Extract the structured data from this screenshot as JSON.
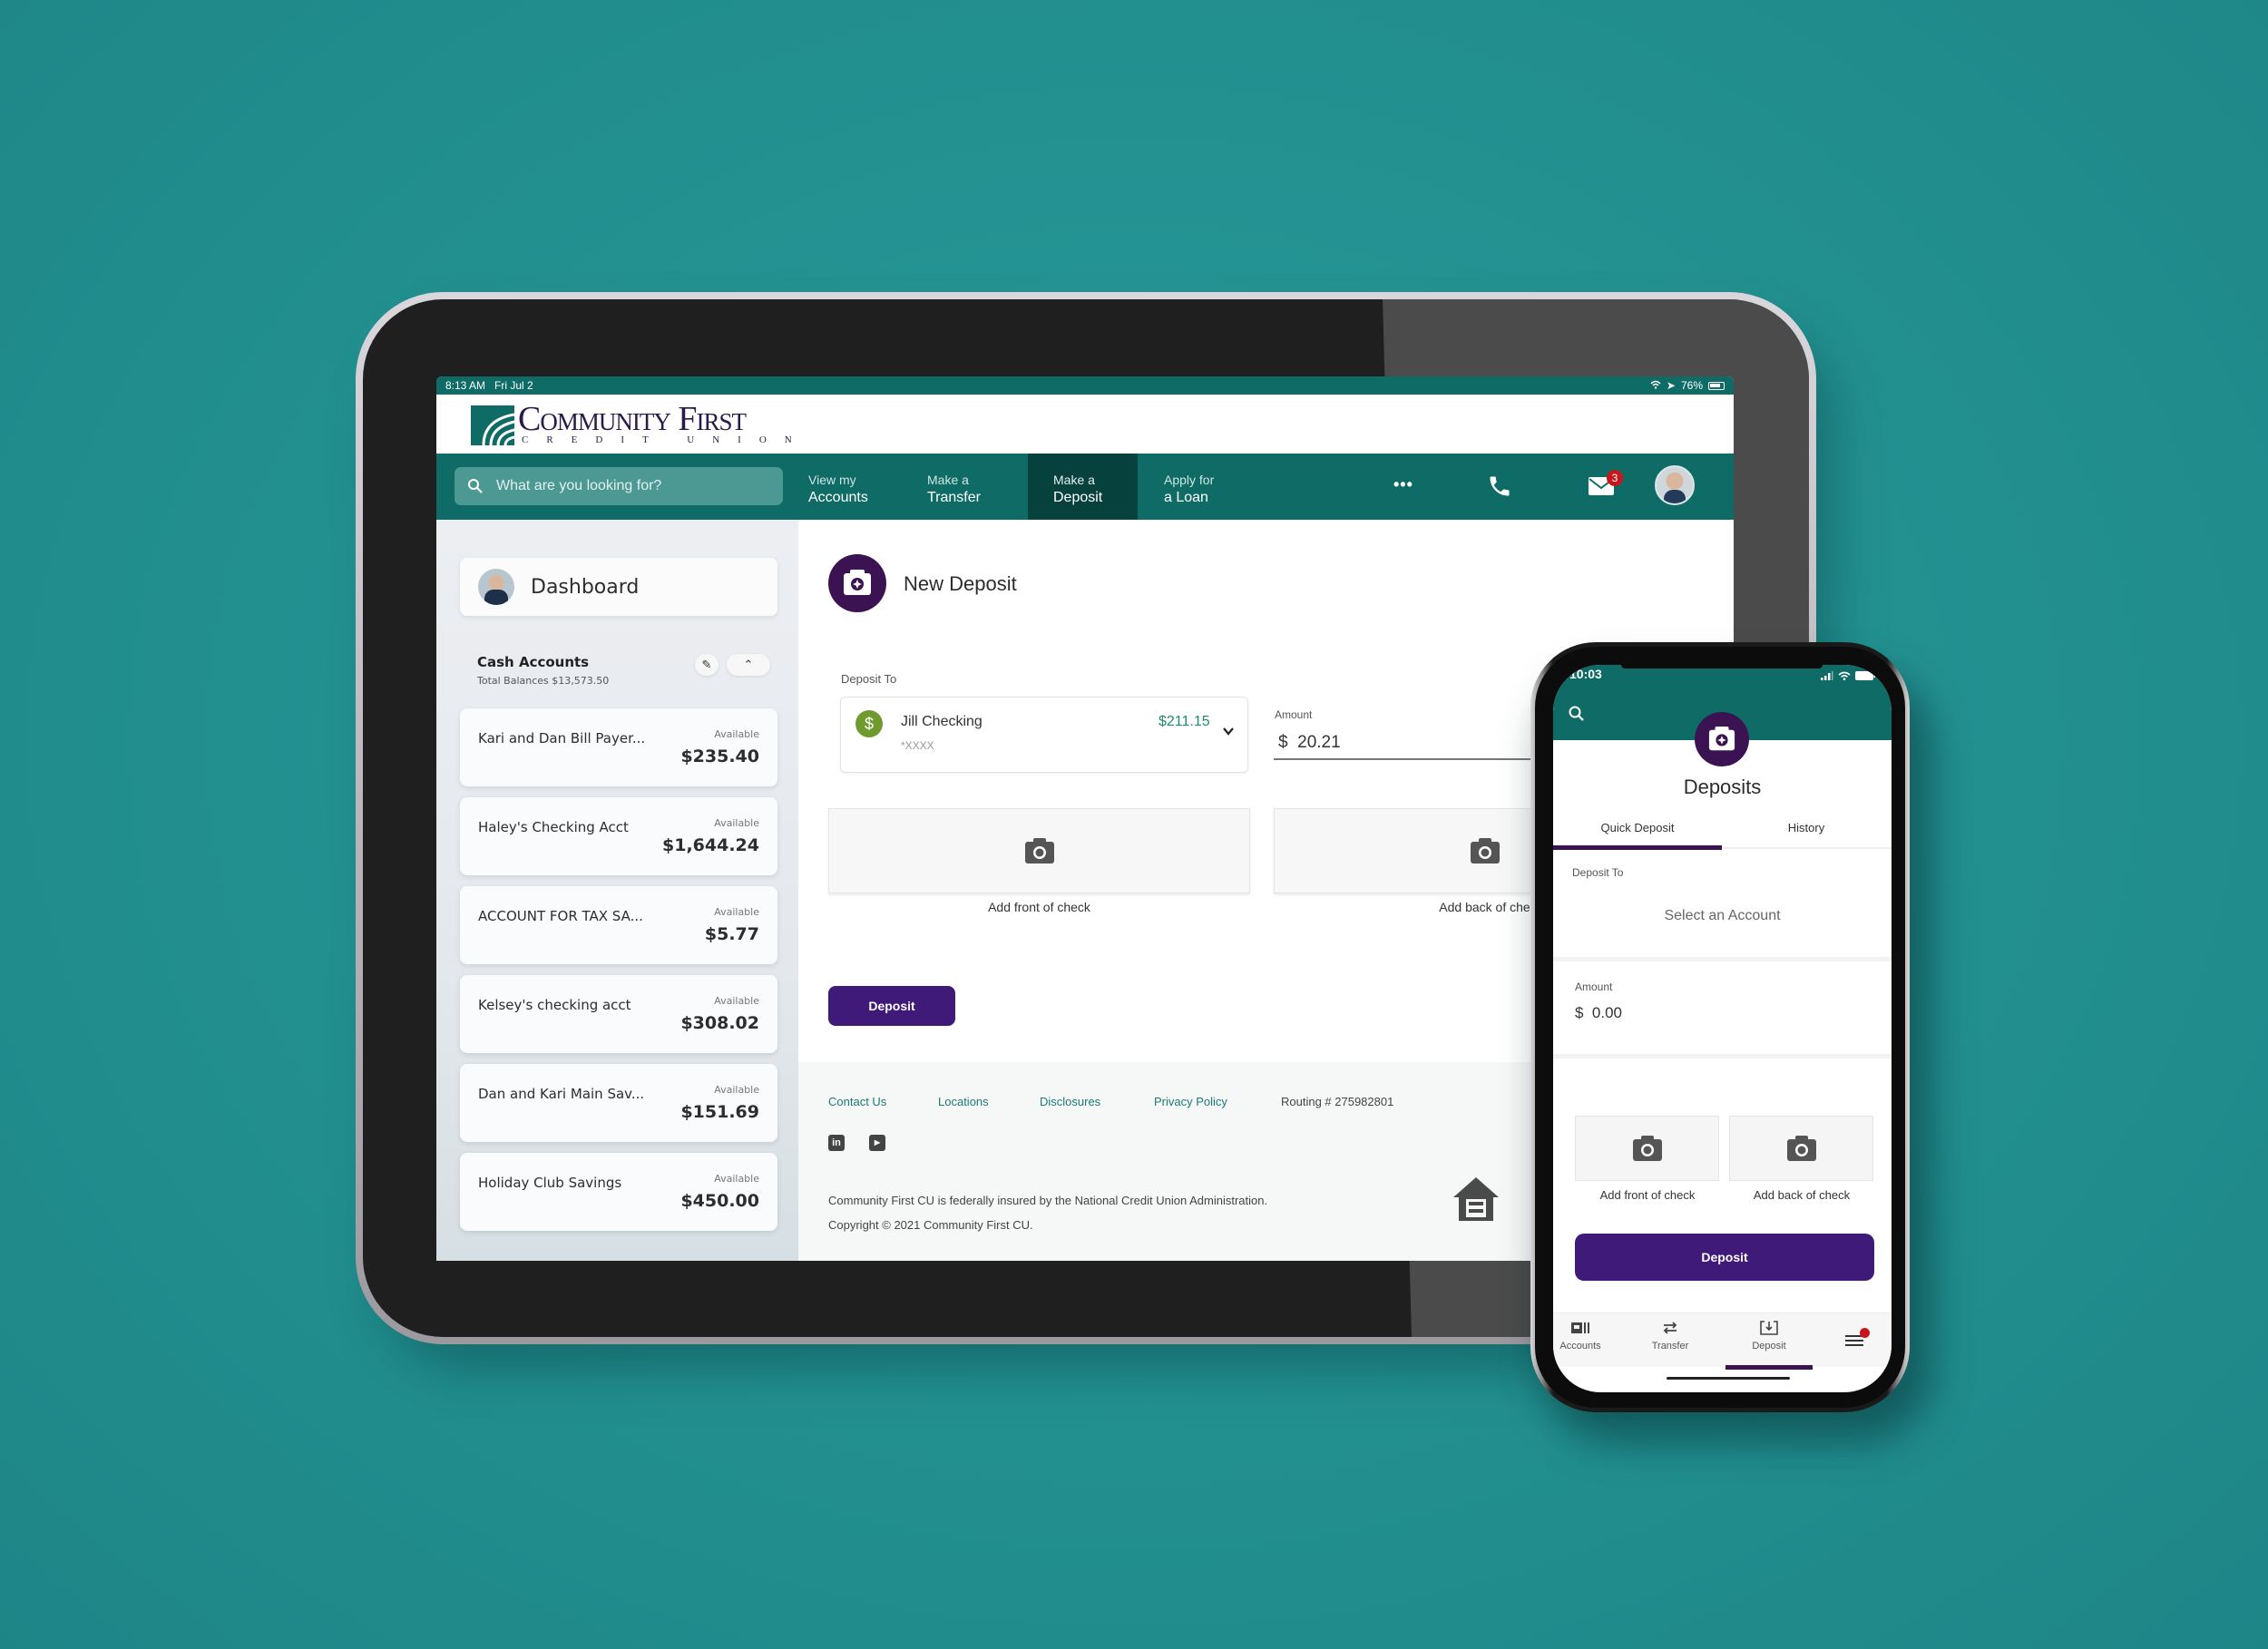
{
  "colors": {
    "background": "#22908f",
    "brand_teal": "#0e6b66",
    "nav_active": "#06413e",
    "brand_purple": "#3c1352",
    "button_purple": "#3f1a78",
    "badge_red": "#c6171d",
    "balance_green": "#1f8a6f"
  },
  "tablet": {
    "status_bar": {
      "time": "8:13 AM",
      "date": "Fri Jul 2",
      "battery": "76%"
    },
    "logo": {
      "name": "Community First",
      "subtitle": "CREDIT UNION"
    },
    "nav": {
      "search_placeholder": "What are you looking for?",
      "items": [
        {
          "small": "View my",
          "label": "Accounts",
          "active": false
        },
        {
          "small": "Make a",
          "label": "Transfer",
          "active": false
        },
        {
          "small": "Make a",
          "label": "Deposit",
          "active": true
        },
        {
          "small": "Apply for",
          "label": "a Loan",
          "active": false
        }
      ],
      "more_icon": "•••",
      "mail_badge": "3"
    },
    "sidebar": {
      "dashboard_label": "Dashboard",
      "section_title": "Cash Accounts",
      "total_balances": "Total Balances $13,573.50",
      "accounts": [
        {
          "name": "Kari and Dan Bill Payer...",
          "available_label": "Available",
          "balance": "$235.40"
        },
        {
          "name": "Haley's Checking Acct",
          "available_label": "Available",
          "balance": "$1,644.24"
        },
        {
          "name": "ACCOUNT FOR TAX SA...",
          "available_label": "Available",
          "balance": "$5.77"
        },
        {
          "name": "Kelsey's checking acct",
          "available_label": "Available",
          "balance": "$308.02"
        },
        {
          "name": "Dan and Kari Main Sav...",
          "available_label": "Available",
          "balance": "$151.69"
        },
        {
          "name": "Holiday Club Savings",
          "available_label": "Available",
          "balance": "$450.00"
        }
      ]
    },
    "main": {
      "title": "New Deposit",
      "deposit_to_label": "Deposit To",
      "selected_account": {
        "name": "Jill Checking",
        "mask": "*XXXX",
        "balance": "$211.15"
      },
      "amount_label": "Amount",
      "amount_value": "$  20.21",
      "front_check_label": "Add front of check",
      "back_check_label": "Add back of che",
      "deposit_button": "Deposit"
    },
    "footer": {
      "links": [
        "Contact Us",
        "Locations",
        "Disclosures",
        "Privacy Policy"
      ],
      "routing": "Routing # 275982801",
      "social": [
        "in",
        "▶"
      ],
      "insured_text": "Community First CU is federally insured by the National Credit Union Administration.",
      "copyright": "Copyright © 2021 Community First CU."
    }
  },
  "phone": {
    "status_bar": {
      "time": "10:03"
    },
    "title": "Deposits",
    "tabs": [
      {
        "label": "Quick Deposit",
        "active": true
      },
      {
        "label": "History",
        "active": false
      }
    ],
    "deposit_to_label": "Deposit To",
    "select_placeholder": "Select an Account",
    "amount_label": "Amount",
    "amount_value": "$  0.00",
    "front_check_label": "Add front of check",
    "back_check_label": "Add back of check",
    "deposit_button": "Deposit",
    "bottom_nav": [
      {
        "label": "Accounts",
        "active": false
      },
      {
        "label": "Transfer",
        "active": false
      },
      {
        "label": "Deposit",
        "active": true
      }
    ]
  }
}
